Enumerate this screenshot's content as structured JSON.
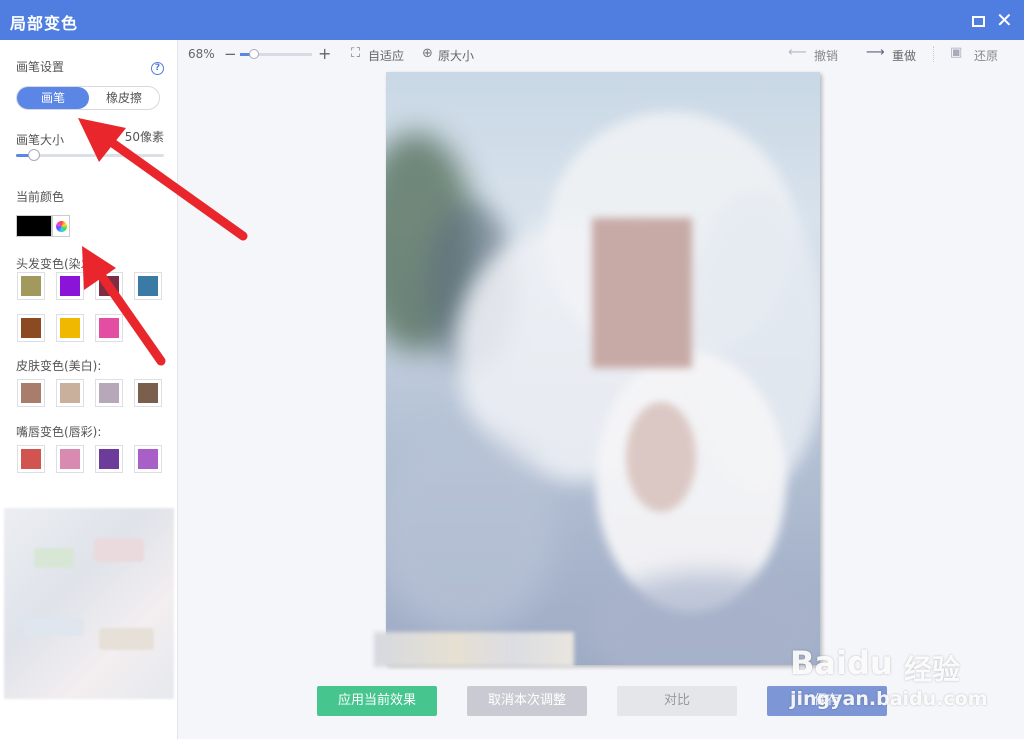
{
  "window": {
    "title": "局部变色"
  },
  "sidebar": {
    "brush_settings_label": "画笔设置",
    "help_label": "?",
    "modes": {
      "brush": "画笔",
      "eraser": "橡皮擦"
    },
    "brush_size_label": "画笔大小",
    "brush_size_value": "50像素",
    "brush_size_fraction": 0.12,
    "current_color_label": "当前颜色",
    "current_color": "#000000",
    "hair_label": "头发变色(染发):",
    "hair_colors": [
      "#a19a5c",
      "#8a14d8",
      "#7d2e45",
      "#3a7aa5",
      "#8c4a22",
      "#f0b800",
      "#e44ea2"
    ],
    "skin_label": "皮肤变色(美白):",
    "skin_colors": [
      "#a97d6b",
      "#c8b09c",
      "#b6a8b8",
      "#7a5f4c"
    ],
    "lip_label": "嘴唇变色(唇彩):",
    "lip_colors": [
      "#d25450",
      "#d98ab0",
      "#6d3b99",
      "#a860c8"
    ]
  },
  "toolbar": {
    "zoom_level": "68%",
    "zoom_fraction": 0.2,
    "minus_label": "−",
    "plus_label": "+",
    "fit_label": "自适应",
    "original_label": "原大小",
    "undo_label": "撤销",
    "redo_label": "重做",
    "restore_label": "还原"
  },
  "actions": {
    "apply": "应用当前效果",
    "cancel": "取消本次调整",
    "compare": "对比",
    "save": "保存"
  },
  "watermark": {
    "brand": "Baidu",
    "brand_cn": "经验",
    "url": "jingyan.baidu.com"
  },
  "colors": {
    "accent": "#4f7ee0",
    "apply": "#46c58e",
    "arrow": "#e8262b"
  }
}
